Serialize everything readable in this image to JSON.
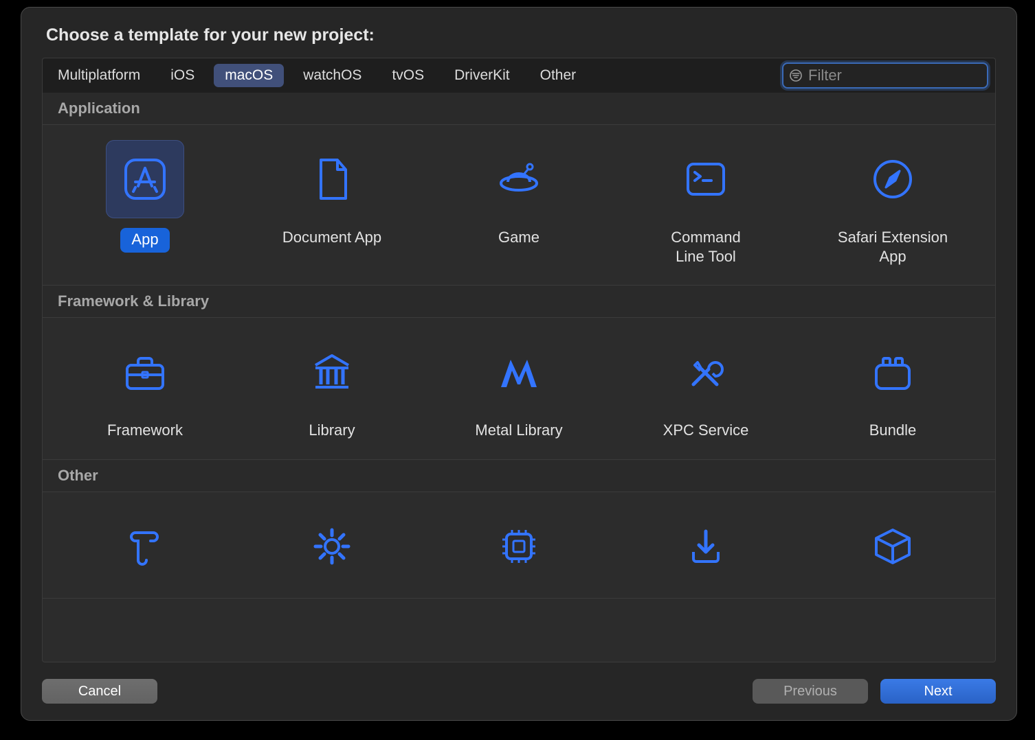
{
  "title": "Choose a template for your new project:",
  "tabs": [
    {
      "label": "Multiplatform",
      "selected": false
    },
    {
      "label": "iOS",
      "selected": false
    },
    {
      "label": "macOS",
      "selected": true
    },
    {
      "label": "watchOS",
      "selected": false
    },
    {
      "label": "tvOS",
      "selected": false
    },
    {
      "label": "DriverKit",
      "selected": false
    },
    {
      "label": "Other",
      "selected": false
    }
  ],
  "filter": {
    "placeholder": "Filter",
    "value": ""
  },
  "sections": [
    {
      "title": "Application",
      "items": [
        {
          "name": "app",
          "label": "App",
          "selected": true
        },
        {
          "name": "document-app",
          "label": "Document App",
          "selected": false
        },
        {
          "name": "game",
          "label": "Game",
          "selected": false
        },
        {
          "name": "command-line",
          "label": "Command\nLine Tool",
          "selected": false
        },
        {
          "name": "safari-ext-app",
          "label": "Safari Extension\nApp",
          "selected": false
        }
      ]
    },
    {
      "title": "Framework & Library",
      "items": [
        {
          "name": "framework",
          "label": "Framework",
          "selected": false
        },
        {
          "name": "library",
          "label": "Library",
          "selected": false
        },
        {
          "name": "metal-library",
          "label": "Metal Library",
          "selected": false
        },
        {
          "name": "xpc-service",
          "label": "XPC Service",
          "selected": false
        },
        {
          "name": "bundle",
          "label": "Bundle",
          "selected": false
        }
      ]
    },
    {
      "title": "Other",
      "items": [
        {
          "name": "applescript-app",
          "label": "",
          "selected": false
        },
        {
          "name": "system-extension",
          "label": "",
          "selected": false
        },
        {
          "name": "driver-extension",
          "label": "",
          "selected": false
        },
        {
          "name": "installer-plugin",
          "label": "",
          "selected": false
        },
        {
          "name": "generic-package",
          "label": "",
          "selected": false
        }
      ]
    }
  ],
  "buttons": {
    "cancel": "Cancel",
    "previous": "Previous",
    "next": "Next"
  },
  "colors": {
    "accent": "#3374ff",
    "selection": "#2d3a5e",
    "primaryButton": "#2a6ad2"
  }
}
